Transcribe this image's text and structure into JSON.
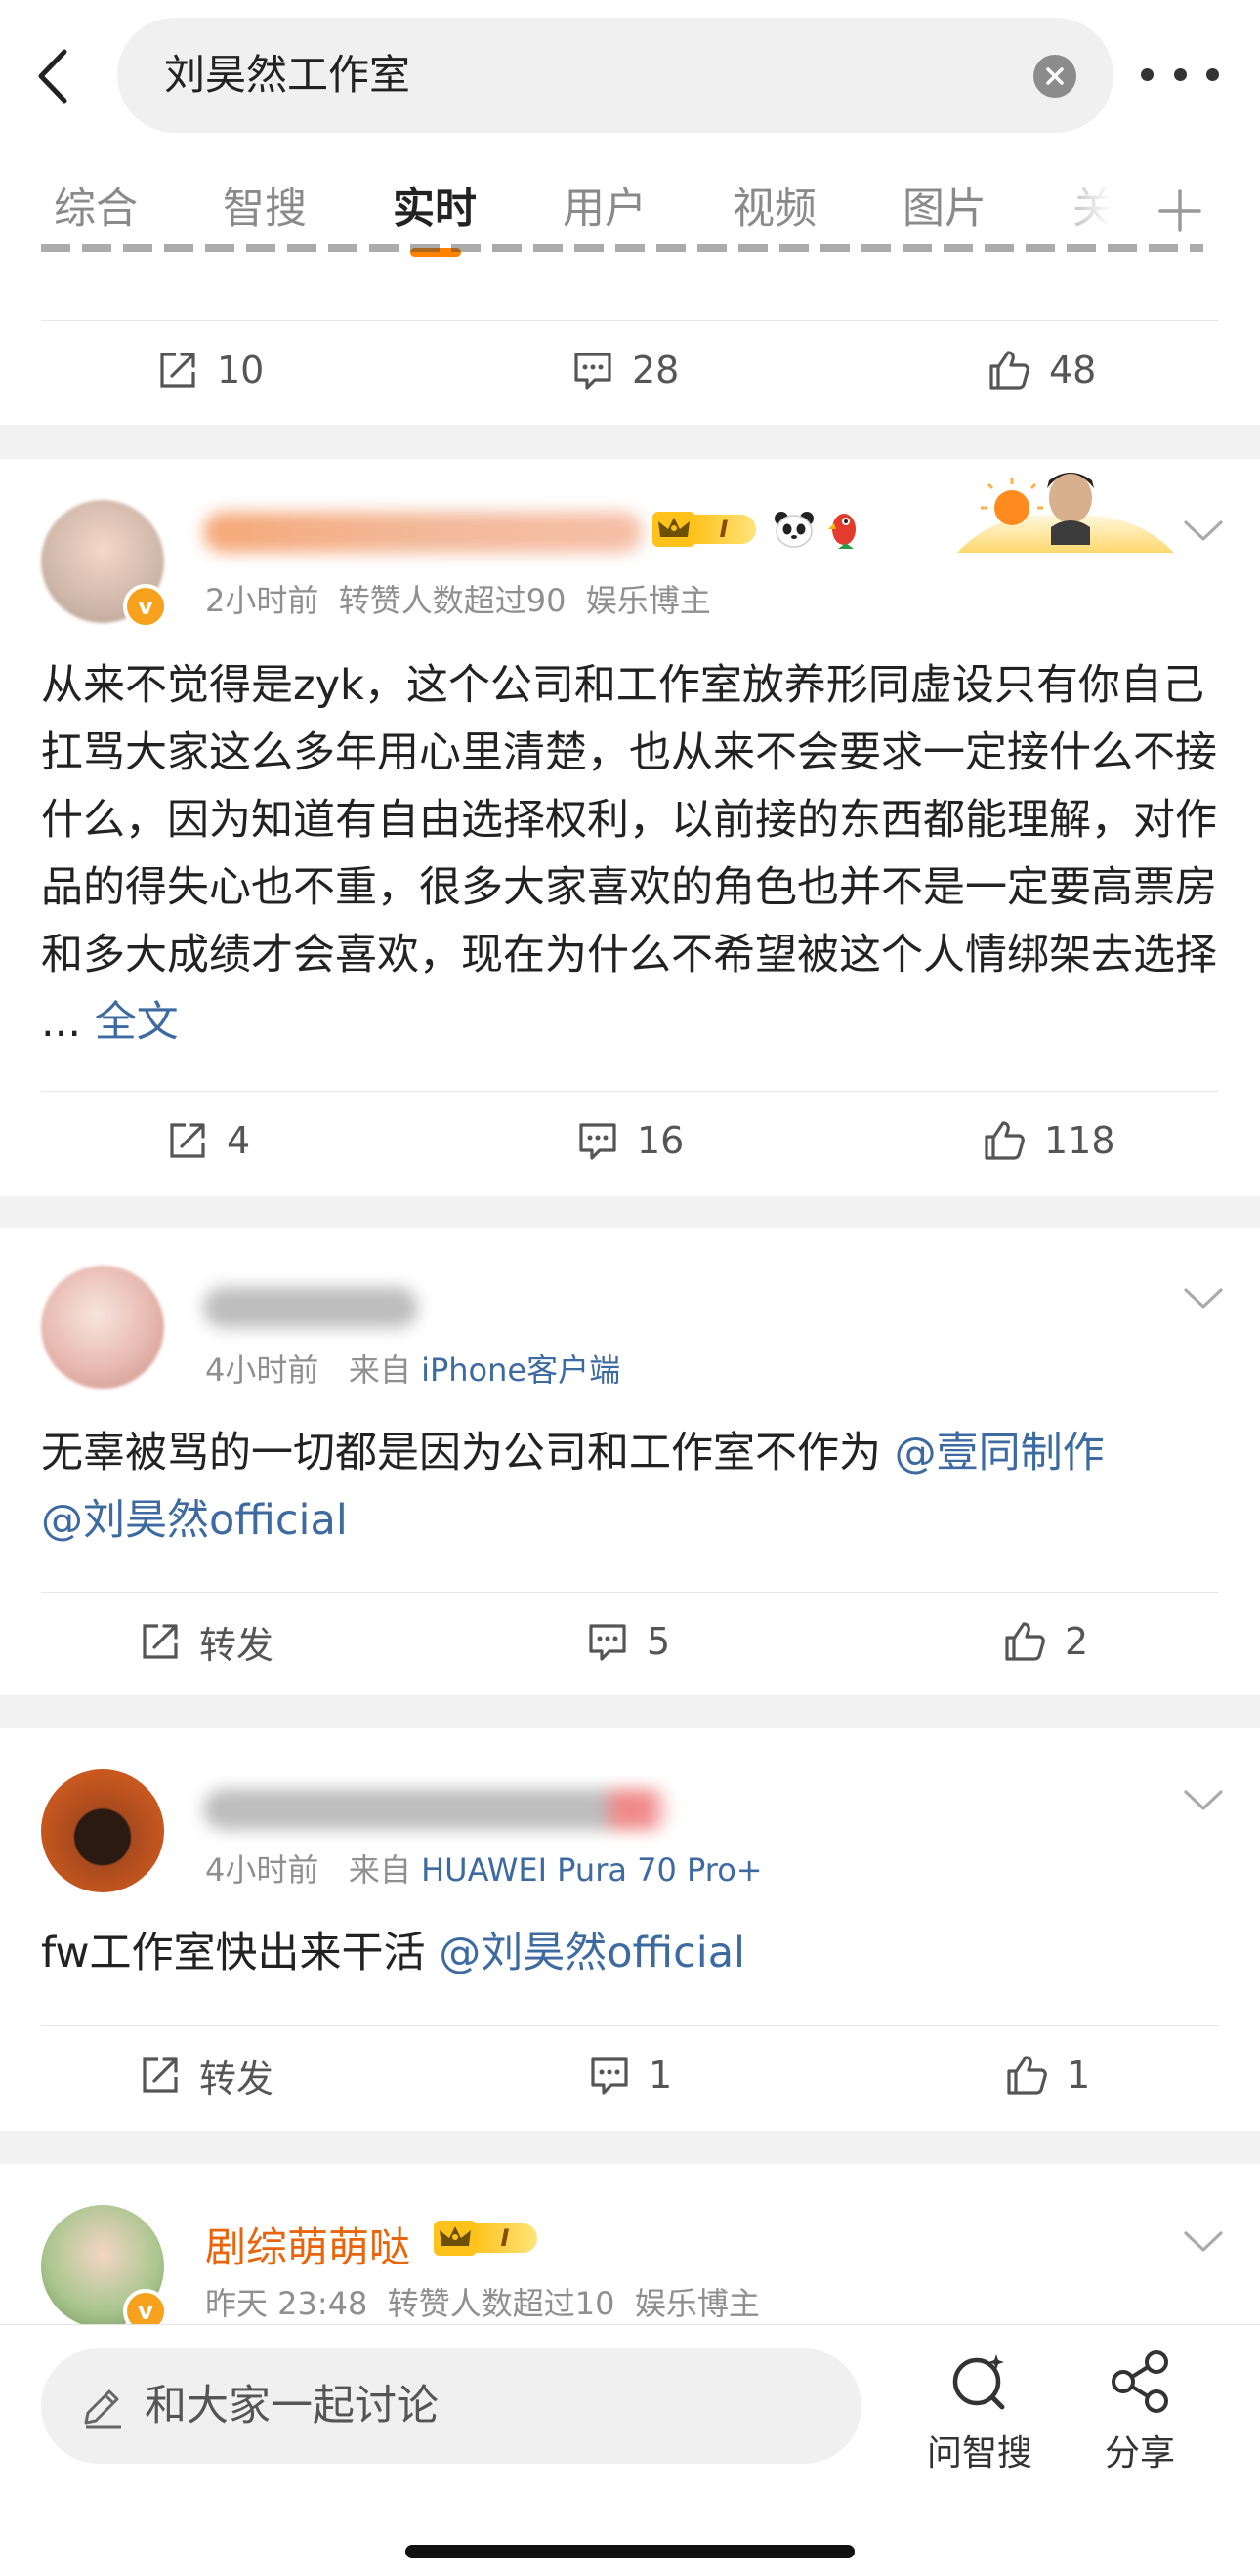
{
  "search": {
    "query": "刘昊然工作室"
  },
  "tabs": [
    {
      "label": "综合"
    },
    {
      "label": "智搜"
    },
    {
      "label": "实时",
      "active": true
    },
    {
      "label": "用户"
    },
    {
      "label": "视频"
    },
    {
      "label": "图片"
    },
    {
      "label": "关"
    }
  ],
  "post0": {
    "repost": "10",
    "comment": "28",
    "like": "48"
  },
  "post1": {
    "time": "2小时前",
    "info": "转赞人数超过90",
    "role": "娱乐博主",
    "vip_level": "I",
    "text": "从来不觉得是zyk，这个公司和工作室放养形同虚设只有你自己扛骂大家这么多年用心里清楚，也从来不会要求一定接什么不接什么，因为知道有自由选择权利，以前接的东西都能理解，对作品的得失心也不重，很多大家喜欢的角色也并不是一定要高票房和多大成绩才会喜欢，现在为什么不希望被这个人情绑架去选择 ...",
    "more": "全文",
    "repost": "4",
    "comment": "16",
    "like": "118"
  },
  "post2": {
    "time": "4小时前",
    "from_label": "来自",
    "source": "iPhone客户端",
    "text": "无辜被骂的一切都是因为公司和工作室不作为",
    "mention1": "@壹同制作",
    "mention2": "@刘昊然official",
    "repost": "转发",
    "comment": "5",
    "like": "2"
  },
  "post3": {
    "time": "4小时前",
    "from_label": "来自",
    "source": "HUAWEI Pura 70 Pro+",
    "text": "fw工作室快出来干活",
    "mention1": "@刘昊然official",
    "repost": "转发",
    "comment": "1",
    "like": "1"
  },
  "post4": {
    "name": "剧综萌萌哒",
    "vip_level": "I",
    "time": "昨天 23:48",
    "info": "转赞人数超过10",
    "role": "娱乐博主"
  },
  "bottom": {
    "placeholder": "和大家一起讨论",
    "ask": "问智搜",
    "share": "分享"
  },
  "colors": {
    "accent": "#ff8200",
    "link": "#3d6aa0",
    "name": "#e8650c"
  }
}
